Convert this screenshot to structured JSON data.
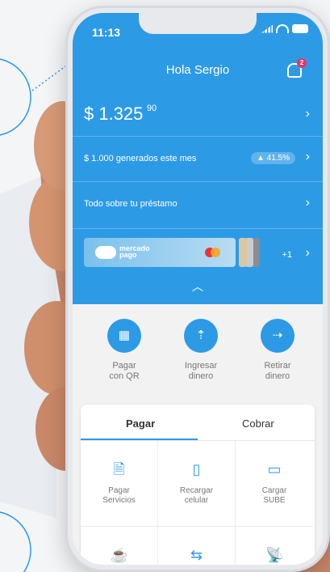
{
  "status": {
    "time": "11:13"
  },
  "header": {
    "greeting": "Hola Sergio",
    "notification_count": "2"
  },
  "balance": {
    "amount": "$ 1.325",
    "cents": "90"
  },
  "earnings": {
    "label": "$ 1.000 generados este mes",
    "percent": "▲ 41.5%"
  },
  "loan": {
    "label": "Todo sobre tu préstamo"
  },
  "cards": {
    "brand_line1": "mercado",
    "brand_line2": "pago",
    "more": "+1"
  },
  "actions": [
    {
      "line1": "Pagar",
      "line2": "con QR",
      "icon": "qr-icon"
    },
    {
      "line1": "Ingresar",
      "line2": "dinero",
      "icon": "deposit-icon"
    },
    {
      "line1": "Retirar",
      "line2": "dinero",
      "icon": "withdraw-icon"
    }
  ],
  "tabs": {
    "pay": "Pagar",
    "collect": "Cobrar"
  },
  "services": [
    {
      "line1": "Pagar",
      "line2": "Servicios",
      "icon": "bill-icon"
    },
    {
      "line1": "Recargar",
      "line2": "celular",
      "icon": "phone-recharge-icon"
    },
    {
      "line1": "Cargar",
      "line2": "SUBE",
      "icon": "transport-card-icon"
    },
    {
      "line1": "",
      "line2": "",
      "icon": "cup-icon"
    },
    {
      "line1": "",
      "line2": "",
      "icon": "cash-transfer-icon"
    },
    {
      "line1": "",
      "line2": "",
      "icon": "satellite-icon"
    }
  ],
  "colors": {
    "brand_blue": "#2d9ae6",
    "badge_pink": "#e6356a"
  }
}
